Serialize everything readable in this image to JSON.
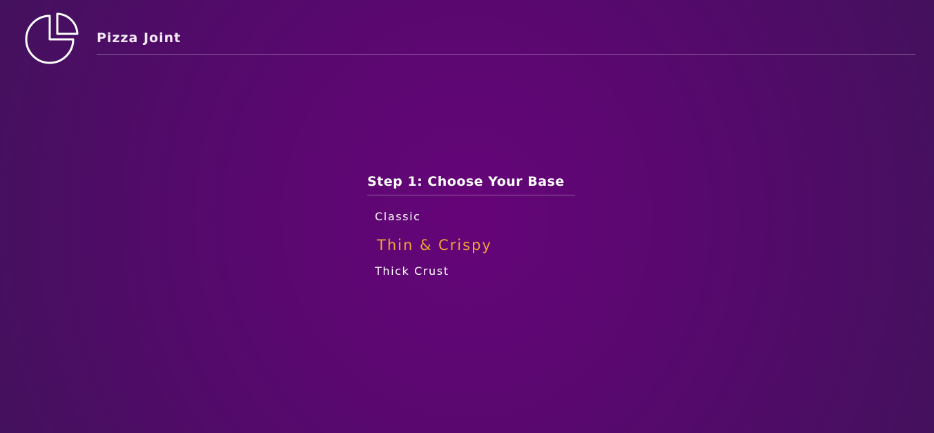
{
  "brand": {
    "name": "Pizza Joint",
    "logo_icon": "pizza-slice-chart-icon"
  },
  "step": {
    "title": "Step 1: Choose Your Base",
    "options": [
      {
        "label": "Classic",
        "selected": false
      },
      {
        "label": "Thin & Crispy",
        "selected": true
      },
      {
        "label": "Thick Crust",
        "selected": false
      }
    ]
  },
  "colors": {
    "background": "#650478",
    "highlight": "#f1a536",
    "text": "#ffffff"
  }
}
